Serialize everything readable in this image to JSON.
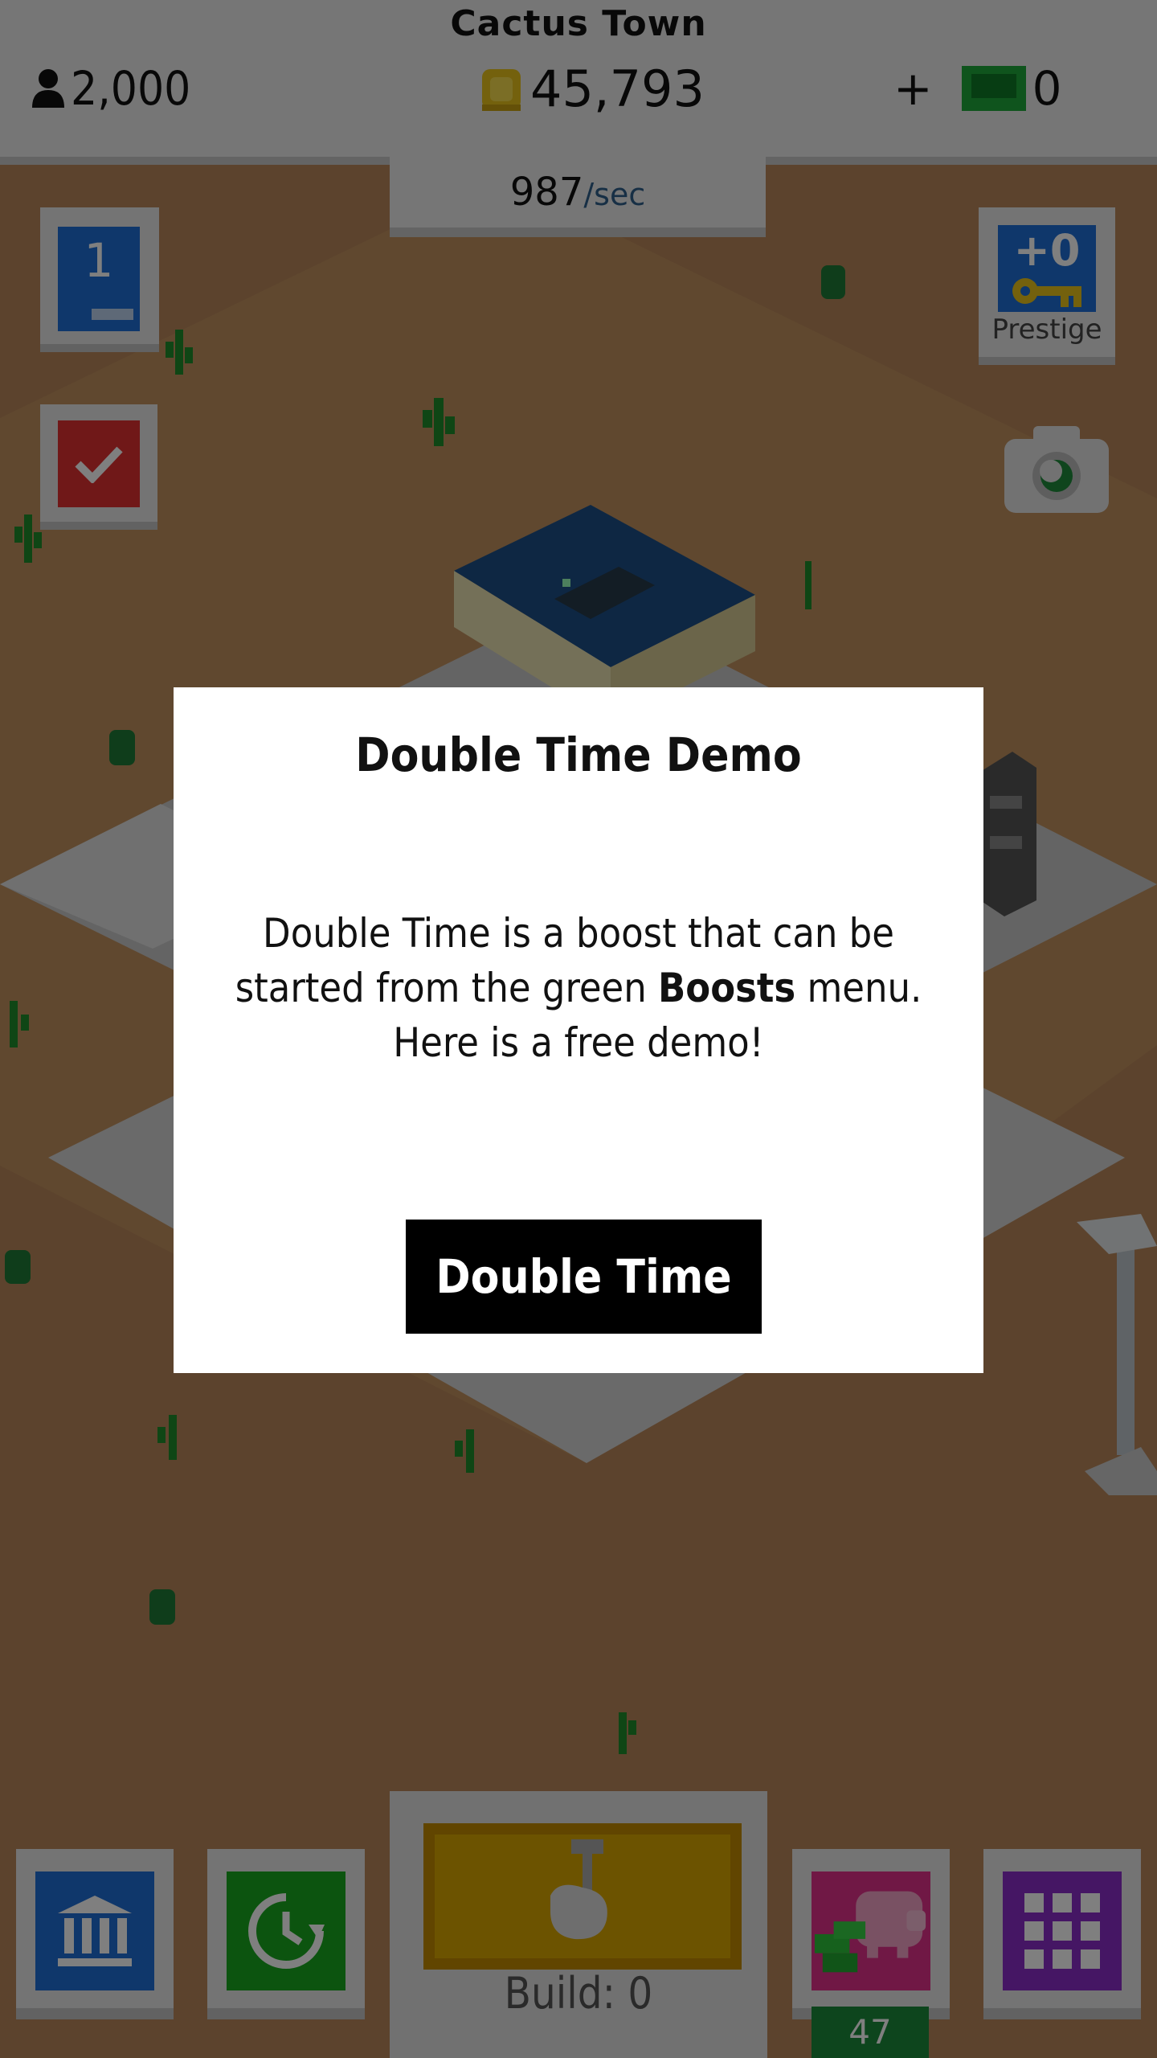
{
  "hud": {
    "town_name": "Cactus Town",
    "population": "2,000",
    "coins": "45,793",
    "cash_plus": "+",
    "cash": "0",
    "rate_value": "987",
    "rate_unit": "/sec"
  },
  "side": {
    "level": "1",
    "level_progress": 0.4,
    "prestige_count": "+0",
    "prestige_label": "Prestige"
  },
  "bottom": {
    "build_label": "Build: 0",
    "savings_count": "47"
  },
  "dialog": {
    "title": "Double Time Demo",
    "body_line1": "Double Time is a boost that can be",
    "body_line2_pre": "started from the green ",
    "body_line2_bold": "Boosts",
    "body_line2_post": " menu.",
    "body_line3": "Here is a free demo!",
    "button_label": "Double Time"
  },
  "icons": [
    "person-icon",
    "coin-icon",
    "cash-icon",
    "checkmark-icon",
    "key-icon",
    "camera-icon",
    "bank-icon",
    "clock-icon",
    "hammer-hand-icon",
    "piggy-bank-icon",
    "grid-icon",
    "cactus-icon"
  ],
  "colors": {
    "ground": "#b8875a",
    "level_blue": "#1e6fd6",
    "goals_red": "#e03030",
    "boost_green": "#18a81e",
    "grid_purple": "#8a2cc8",
    "build_yellow": "#d9a600"
  }
}
